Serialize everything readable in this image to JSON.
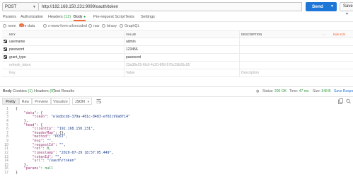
{
  "request": {
    "method": "POST",
    "url": "http://192.168.150.231:9099/oauth/token",
    "send_label": "Send",
    "save_label": "Save"
  },
  "request_tabs": [
    {
      "label": "Params"
    },
    {
      "label": "Authorization"
    },
    {
      "label": "Headers",
      "count": "(12)"
    },
    {
      "label": "Body",
      "indicator": "●"
    },
    {
      "label": "Pre-request Script"
    },
    {
      "label": "Tests"
    },
    {
      "label": "Settings"
    }
  ],
  "body_types": [
    {
      "label": "none"
    },
    {
      "label": "form-data"
    },
    {
      "label": "x-www-form-urlencoded"
    },
    {
      "label": "raw"
    },
    {
      "label": "binary"
    },
    {
      "label": "GraphQL"
    }
  ],
  "kv_table": {
    "headers": {
      "key": "KEY",
      "value": "VALUE",
      "description": "DESCRIPTION",
      "bulk_edit": "Bulk Edit"
    },
    "rows": [
      {
        "key": "username",
        "value": "admin",
        "checked": true
      },
      {
        "key": "password",
        "value": "123456",
        "checked": true
      },
      {
        "key": "grant_type",
        "value": "password",
        "checked": true
      },
      {
        "key": "refresh_token",
        "value": "23a38e25-6fc0-4c20-8f5f-576c29b26c95",
        "checked": false
      }
    ],
    "placeholder": {
      "key": "Key",
      "value": "Value",
      "description": "Description"
    }
  },
  "response_tabs": [
    {
      "label": "Body"
    },
    {
      "label": "Cookies",
      "count": "(1)"
    },
    {
      "label": "Headers",
      "count": "(9)"
    },
    {
      "label": "Test Results"
    }
  ],
  "response_status": {
    "status_label": "Status:",
    "status_value": "200 OK",
    "time_label": "Time:",
    "time_value": "47 ms",
    "size_label": "Size:",
    "size_value": "548 B",
    "save_response": "Save Response ▾"
  },
  "view_modes": [
    {
      "label": "Pretty"
    },
    {
      "label": "Raw"
    },
    {
      "label": "Preview"
    },
    {
      "label": "Visualize"
    }
  ],
  "format_select": "JSON",
  "code_lines": [
    "{",
    "    \"data\": {",
    "        \"token\": \"eledbcdb-379a-481c-8483-ef02c99a0f14\"",
    "    },",
    "    \"head\": {",
    "        \"clientIp\": \"192.168.150.231\",",
    "        \"headerMap\": {},",
    "        \"method\": \"POST\",",
    "        \"msg\": \"\",",
    "        \"requestId\": \"\",",
    "        \"ret\": 0,",
    "        \"timestamp\": \"2020-07-29 18:57:05.449\",",
    "        \"tokenId\": \"\",",
    "        \"url\": \"/oauth/token\"",
    "    },",
    "    \"params\": null",
    "}"
  ]
}
